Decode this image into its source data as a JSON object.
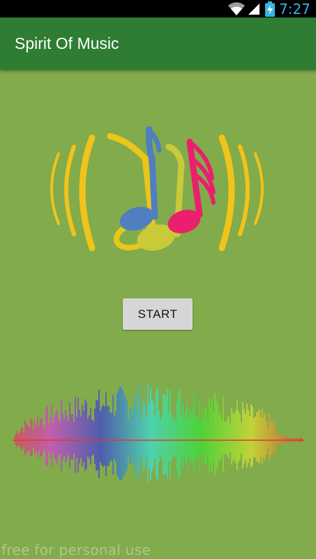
{
  "status_bar": {
    "time": "7:27",
    "icons": [
      "wifi-icon",
      "signal-icon",
      "battery-charging-icon"
    ]
  },
  "app_bar": {
    "title": "Spirit Of Music",
    "color": "#2e7d32"
  },
  "logo": {
    "icon": "music-notes-icon",
    "colors": {
      "arcs": "#f2c31a",
      "note_blue": "#4f7fbf",
      "note_yellow": "#e8c61a",
      "note_olive": "#c9c93a",
      "note_pink": "#ea1f6e"
    }
  },
  "start_button": {
    "label": "START"
  },
  "waveform": {
    "icon": "audio-waveform-icon"
  },
  "watermark": {
    "text": "free for personal use"
  },
  "colors": {
    "background": "#82ab4c",
    "status_time": "#33b5e5"
  }
}
